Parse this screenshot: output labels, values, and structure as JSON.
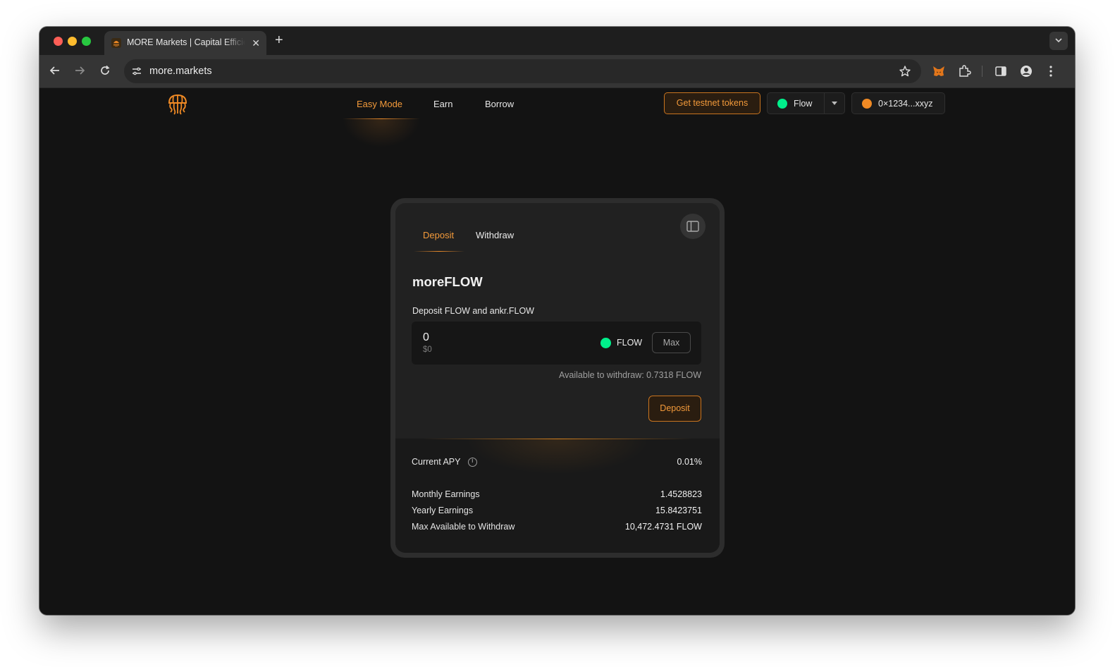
{
  "browser": {
    "tab_title": "MORE Markets | Capital Efficient",
    "tab_close": "✕",
    "new_tab": "+",
    "url": "more.markets"
  },
  "nav": {
    "items": [
      {
        "label": "Easy Mode",
        "active": true
      },
      {
        "label": "Earn",
        "active": false
      },
      {
        "label": "Borrow",
        "active": false
      }
    ],
    "testnet_button": "Get testnet tokens",
    "network": "Flow",
    "wallet": "0×1234...xxyz"
  },
  "card": {
    "tabs": [
      "Deposit",
      "Withdraw"
    ],
    "asset_title": "moreFLOW",
    "description": "Deposit FLOW and ankr.FLOW",
    "amount": "0",
    "amount_usd": "$0",
    "token": "FLOW",
    "max_label": "Max",
    "available": "Available to withdraw: 0.7318 FLOW",
    "submit_label": "Deposit",
    "stats": {
      "apy_label": "Current APY",
      "apy_value": "0.01%",
      "monthly_label": "Monthly Earnings",
      "monthly_value": "1.4528823",
      "yearly_label": "Yearly Earnings",
      "yearly_value": "15.8423751",
      "max_label": "Max Available to Withdraw",
      "max_value": "10,472.4731 FLOW"
    }
  },
  "colors": {
    "accent": "#f39a3a",
    "flow_green": "#00ef8b",
    "background": "#131313"
  }
}
